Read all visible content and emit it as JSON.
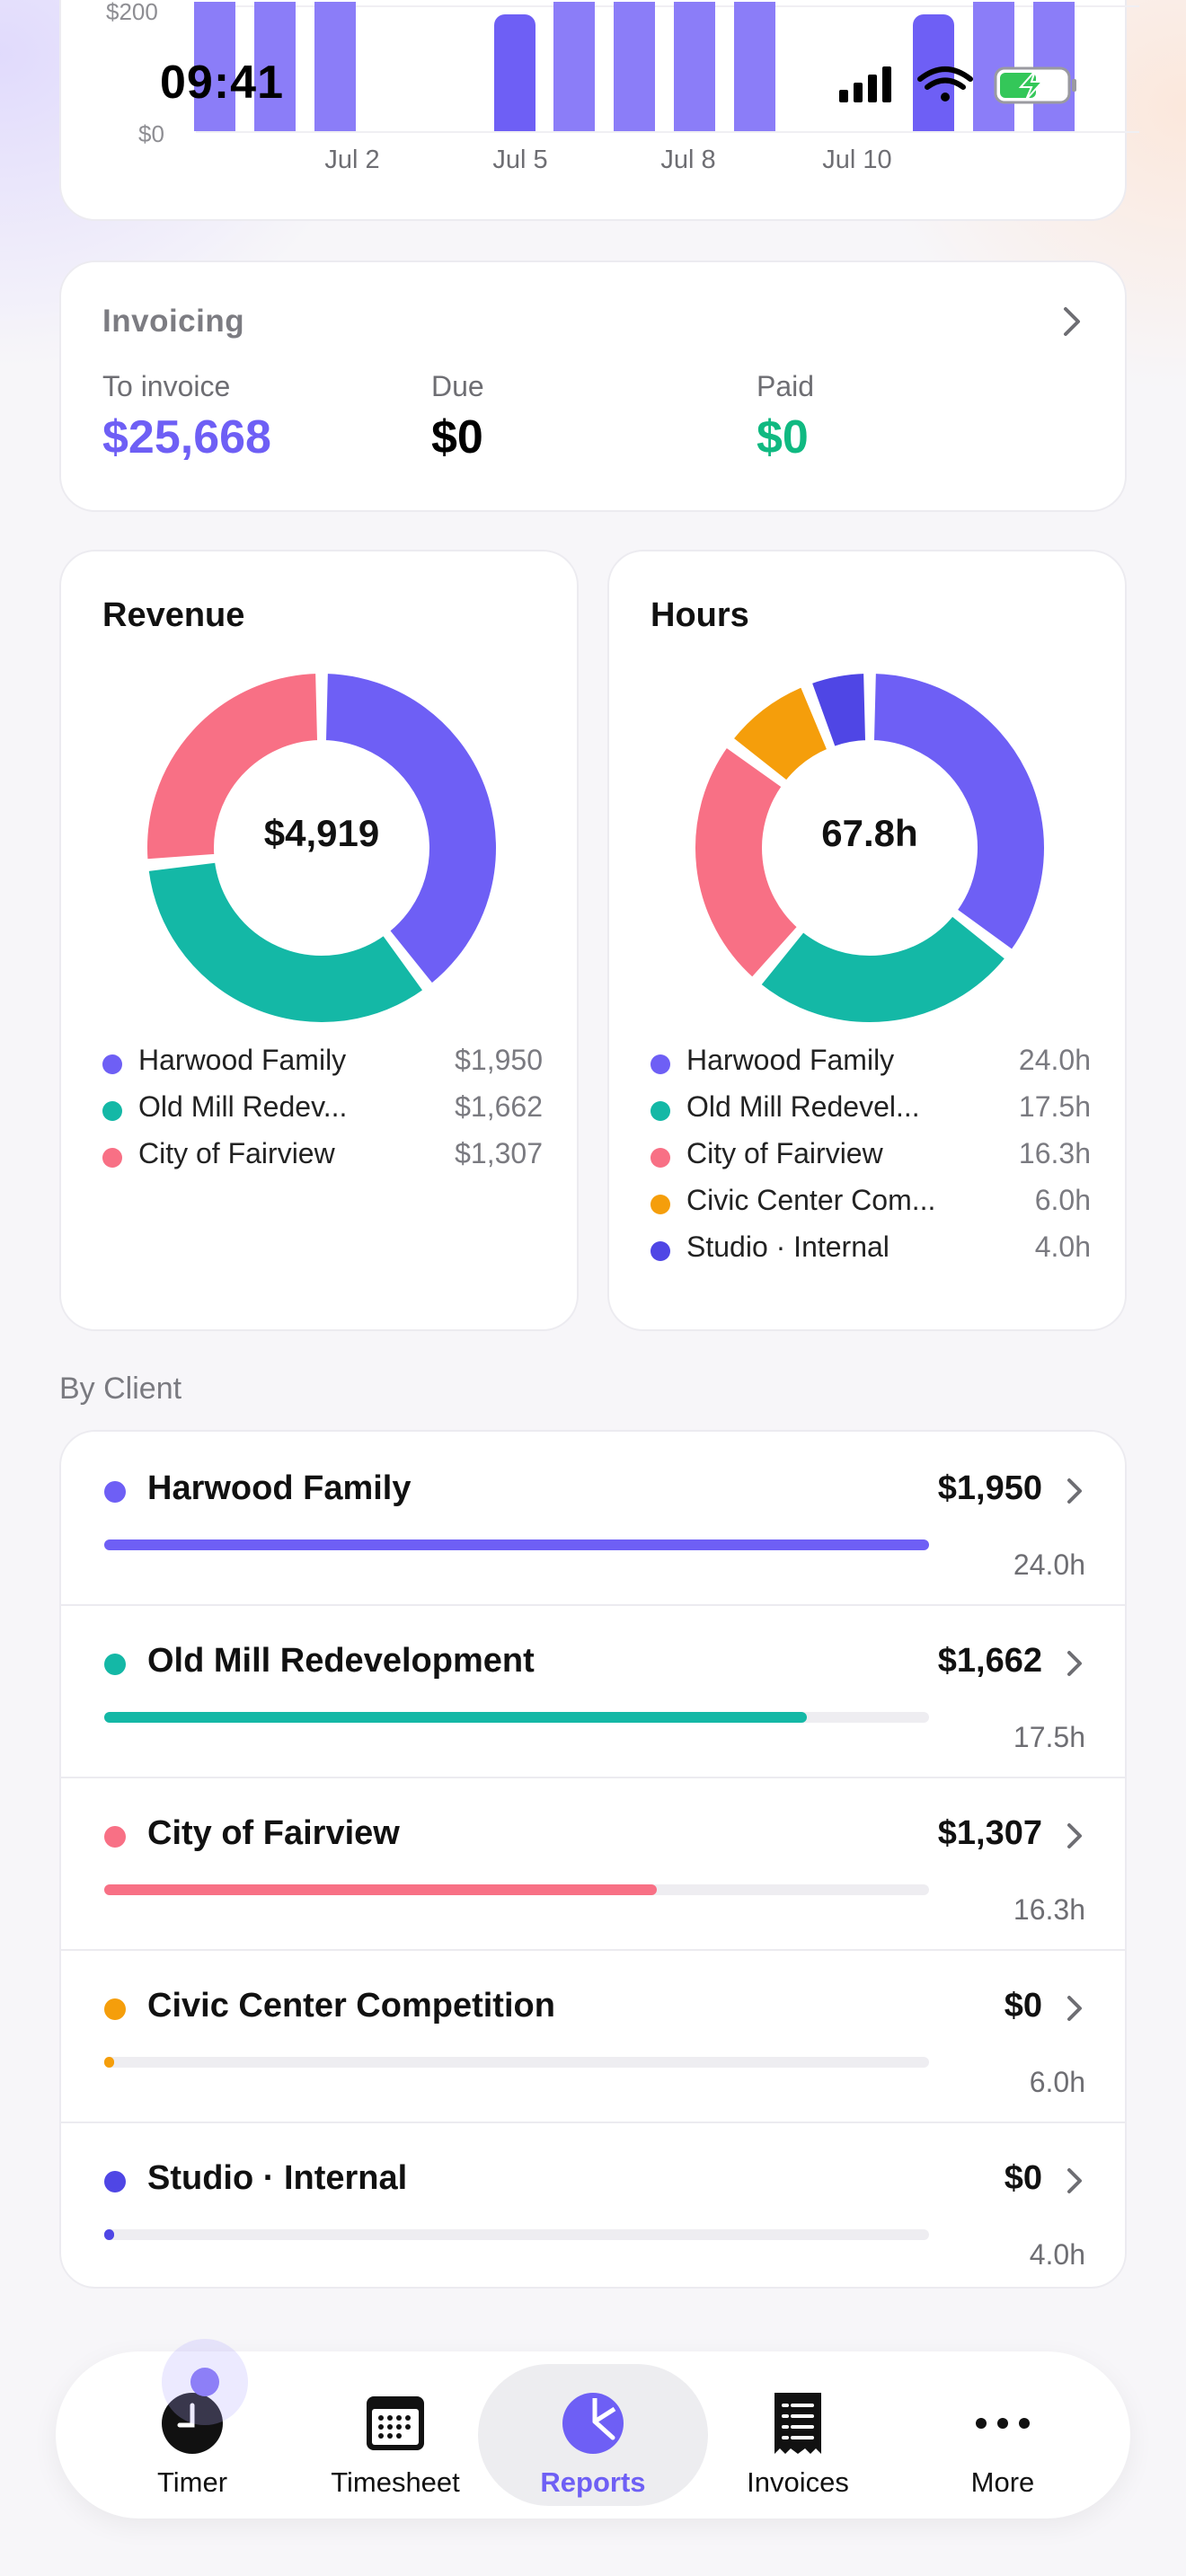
{
  "status_bar": {
    "time": "09:41"
  },
  "colors": {
    "purple": "#6e5ff5",
    "teal": "#14b8a6",
    "pink": "#f87085",
    "orange": "#f59e0b",
    "indigo": "#4f46e5",
    "green": "#10b981"
  },
  "chart_data": {
    "type": "bar",
    "y_ticks": [
      "$200",
      "$0"
    ],
    "x_labels": [
      "Jul 2",
      "Jul 5",
      "Jul 8",
      "Jul 10"
    ]
  },
  "invoicing": {
    "title": "Invoicing",
    "to_invoice_label": "To invoice",
    "to_invoice_value": "$25,668",
    "due_label": "Due",
    "due_value": "$0",
    "paid_label": "Paid",
    "paid_value": "$0"
  },
  "revenue": {
    "title": "Revenue",
    "total": "$4,919",
    "legend": [
      {
        "name": "Harwood Family",
        "value": "$1,950",
        "amount": 1950,
        "color": "#6e5ff5"
      },
      {
        "name": "Old Mill Redev...",
        "value": "$1,662",
        "amount": 1662,
        "color": "#14b8a6"
      },
      {
        "name": "City of Fairview",
        "value": "$1,307",
        "amount": 1307,
        "color": "#f87085"
      }
    ]
  },
  "hours": {
    "title": "Hours",
    "total": "67.8h",
    "legend": [
      {
        "name": "Harwood Family",
        "value": "24.0h",
        "amount": 24.0,
        "color": "#6e5ff5"
      },
      {
        "name": "Old Mill Redevel...",
        "value": "17.5h",
        "amount": 17.5,
        "color": "#14b8a6"
      },
      {
        "name": "City of Fairview",
        "value": "16.3h",
        "amount": 16.3,
        "color": "#f87085"
      },
      {
        "name": "Civic Center Com...",
        "value": "6.0h",
        "amount": 6.0,
        "color": "#f59e0b"
      },
      {
        "name": "Studio · Internal",
        "value": "4.0h",
        "amount": 4.0,
        "color": "#4f46e5"
      }
    ]
  },
  "by_client": {
    "label": "By Client",
    "clients": [
      {
        "name": "Harwood Family",
        "amount": "$1,950",
        "hours": "24.0h",
        "fraction": 1.0,
        "color": "#6e5ff5"
      },
      {
        "name": "Old Mill Redevelopment",
        "amount": "$1,662",
        "hours": "17.5h",
        "fraction": 0.852,
        "color": "#14b8a6"
      },
      {
        "name": "City of Fairview",
        "amount": "$1,307",
        "hours": "16.3h",
        "fraction": 0.67,
        "color": "#f87085"
      },
      {
        "name": "Civic Center Competition",
        "amount": "$0",
        "hours": "6.0h",
        "fraction": 0.012,
        "color": "#f59e0b"
      },
      {
        "name": "Studio · Internal",
        "amount": "$0",
        "hours": "4.0h",
        "fraction": 0.012,
        "color": "#4f46e5"
      }
    ]
  },
  "tabs": [
    {
      "label": "Timer",
      "icon": "clock-icon"
    },
    {
      "label": "Timesheet",
      "icon": "calendar-icon"
    },
    {
      "label": "Reports",
      "icon": "pie-chart-icon",
      "active": true
    },
    {
      "label": "Invoices",
      "icon": "receipt-icon"
    },
    {
      "label": "More",
      "icon": "ellipsis-icon"
    }
  ]
}
